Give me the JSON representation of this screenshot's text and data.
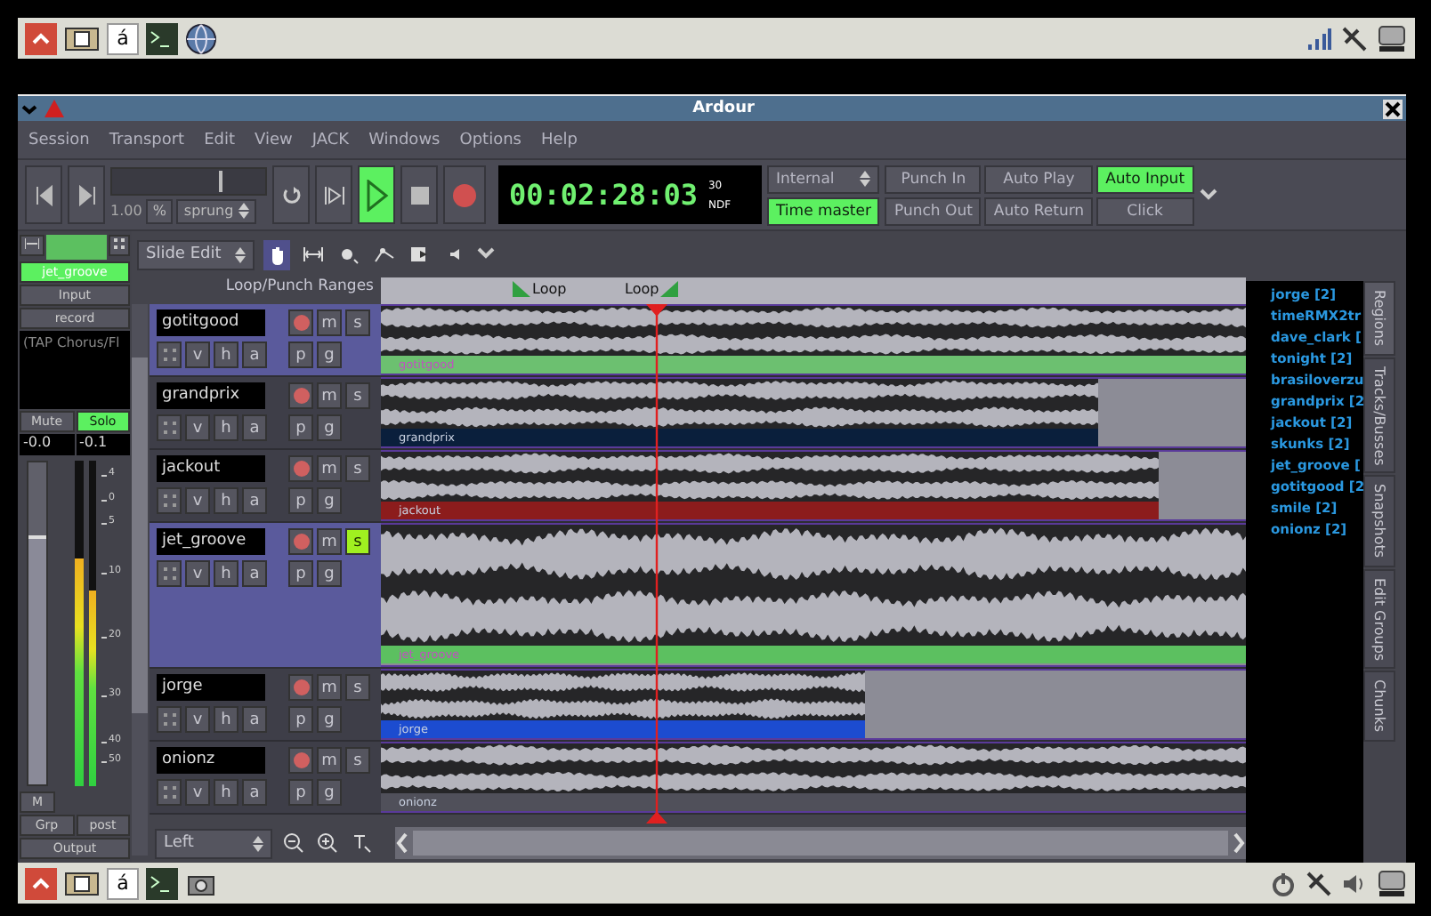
{
  "top_panel": {
    "keyboard_indicator": "á"
  },
  "window": {
    "title": "Ardour"
  },
  "menu": [
    "Session",
    "Transport",
    "Edit",
    "View",
    "JACK",
    "Windows",
    "Options",
    "Help"
  ],
  "transport": {
    "shuttle": {
      "level": 0.7,
      "speed": "1.00",
      "unit": "%",
      "mode": "sprung"
    },
    "play_active": true,
    "clock": {
      "time": "00:02:28:03",
      "fps": "30",
      "mode": "NDF"
    },
    "sync_source": "Internal",
    "time_master": {
      "label": "Time master",
      "on": true
    },
    "options": [
      {
        "label": "Punch In",
        "on": false
      },
      {
        "label": "Punch Out",
        "on": false
      },
      {
        "label": "Auto Play",
        "on": false
      },
      {
        "label": "Auto Return",
        "on": false
      },
      {
        "label": "Auto Input",
        "on": true
      },
      {
        "label": "Click",
        "on": false
      }
    ]
  },
  "edit_toolbar": {
    "edit_mode": "Slide Edit",
    "tools": [
      {
        "kind": "grab",
        "selected": true
      },
      {
        "kind": "range",
        "selected": false
      },
      {
        "kind": "gain",
        "selected": false
      },
      {
        "kind": "draw",
        "selected": false
      },
      {
        "kind": "audition",
        "selected": false
      },
      {
        "kind": "timefx",
        "selected": false
      }
    ]
  },
  "mixer_strip": {
    "name": "jet_groove",
    "input": "Input",
    "record": "record",
    "plugins": [
      "(TAP Chorus/Fl"
    ],
    "mute": {
      "label": "Mute",
      "on": false
    },
    "solo": {
      "label": "Solo",
      "on": true
    },
    "gain": "-0.0",
    "peak": "-0.1",
    "fader": {
      "level": 0.76
    },
    "meters": [
      {
        "level": 0.7
      },
      {
        "level": 0.6
      }
    ],
    "meter_scale": [
      "4",
      "0",
      "5",
      "10",
      "20",
      "30",
      "40",
      "50"
    ],
    "meter_point": "M",
    "group": "Grp",
    "meter_mode": "post",
    "output": "Output"
  },
  "editor": {
    "ruler_label": "Loop/Punch Ranges",
    "loop_range": {
      "start_label": "Loop",
      "end_label": "Loop"
    },
    "tracks": [
      {
        "name": "gotitgood",
        "selected": true,
        "kind": "normal",
        "solo": false,
        "buttons": [
          "m",
          "s"
        ],
        "automation": [
          "v",
          "h",
          "a"
        ],
        "extra": [
          "p",
          "g"
        ],
        "region": {
          "label": "gotitgood",
          "color": "#6cc070",
          "level": 1
        }
      },
      {
        "name": "grandprix",
        "selected": false,
        "kind": "normal",
        "solo": false,
        "buttons": [
          "m",
          "s"
        ],
        "automation": [
          "v",
          "h",
          "a"
        ],
        "extra": [
          "p",
          "g"
        ],
        "region": {
          "label": "grandprix",
          "color": "#0a1f3c",
          "level": 0.83
        }
      },
      {
        "name": "jackout",
        "selected": false,
        "kind": "normal",
        "solo": false,
        "buttons": [
          "m",
          "s"
        ],
        "automation": [
          "v",
          "h",
          "a"
        ],
        "extra": [
          "p",
          "g"
        ],
        "region": {
          "label": "jackout",
          "color": "#8c1c1c",
          "level": 0.9
        }
      },
      {
        "name": "jet_groove",
        "selected": true,
        "kind": "tall",
        "solo": true,
        "buttons": [
          "m",
          "s"
        ],
        "automation": [
          "v",
          "h",
          "a"
        ],
        "extra": [
          "p",
          "g"
        ],
        "region": {
          "label": "jet_groove",
          "color": "#5cc060",
          "level": 1
        }
      },
      {
        "name": "jorge",
        "selected": false,
        "kind": "normal",
        "solo": false,
        "buttons": [
          "m",
          "s"
        ],
        "automation": [
          "v",
          "h",
          "a"
        ],
        "extra": [
          "p",
          "g"
        ],
        "region": {
          "label": "jorge",
          "color": "#1c4cd0",
          "level": 0.56
        }
      },
      {
        "name": "onionz",
        "selected": false,
        "kind": "normal",
        "solo": false,
        "buttons": [
          "m",
          "s"
        ],
        "automation": [
          "v",
          "h",
          "a"
        ],
        "extra": [
          "p",
          "g"
        ],
        "region": {
          "label": "onionz",
          "color": "#50505a",
          "level": 1
        }
      }
    ],
    "zoom_focus": "Left"
  },
  "regions_list": [
    "jorge [2]",
    "timeRMX2tr",
    "dave_clark [",
    "tonight [2]",
    "brasiloverzu",
    "grandprix [2",
    "jackout [2]",
    "skunks [2]",
    "jet_groove [",
    "gotitgood [2",
    "smile [2]",
    "onionz [2]"
  ],
  "side_tabs": [
    {
      "label": "Regions",
      "selected": true
    },
    {
      "label": "Tracks/Busses",
      "selected": false
    },
    {
      "label": "Snapshots",
      "selected": false
    },
    {
      "label": "Edit Groups",
      "selected": false
    },
    {
      "label": "Chunks",
      "selected": false
    }
  ],
  "bottom_panel": {
    "keyboard_indicator": "á"
  }
}
